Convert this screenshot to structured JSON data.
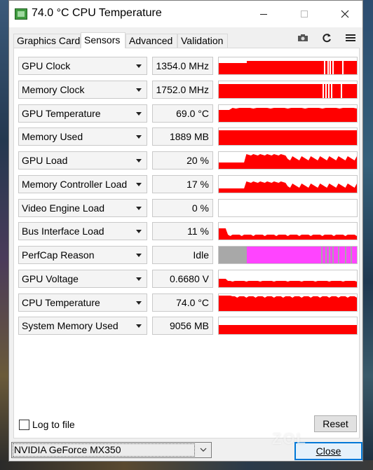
{
  "window": {
    "title": "74.0 °C CPU Temperature",
    "buttons": {
      "minimize": "minimize",
      "maximize": "maximize",
      "close": "close"
    }
  },
  "tabs": [
    {
      "label": "Graphics Card"
    },
    {
      "label": "Sensors",
      "active": true
    },
    {
      "label": "Advanced"
    },
    {
      "label": "Validation"
    }
  ],
  "toolbar": {
    "icons": [
      "camera-icon",
      "refresh-icon",
      "menu-icon"
    ]
  },
  "sensors": [
    {
      "name": "GPU Clock",
      "value": "1354.0 MHz",
      "graph": "clock"
    },
    {
      "name": "Memory Clock",
      "value": "1752.0 MHz",
      "graph": "memclock"
    },
    {
      "name": "GPU Temperature",
      "value": "69.0 °C",
      "graph": "temp"
    },
    {
      "name": "Memory Used",
      "value": "1889 MB",
      "graph": "full"
    },
    {
      "name": "GPU Load",
      "value": "20 %",
      "graph": "load"
    },
    {
      "name": "Memory Controller Load",
      "value": "17 %",
      "graph": "mcload"
    },
    {
      "name": "Video Engine Load",
      "value": "0 %",
      "graph": "empty"
    },
    {
      "name": "Bus Interface Load",
      "value": "11 %",
      "graph": "bus"
    },
    {
      "name": "PerfCap Reason",
      "value": "Idle",
      "graph": "perfcap"
    },
    {
      "name": "GPU Voltage",
      "value": "0.6680 V",
      "graph": "voltage"
    },
    {
      "name": "CPU Temperature",
      "value": "74.0 °C",
      "graph": "cputemp"
    },
    {
      "name": "System Memory Used",
      "value": "9056 MB",
      "graph": "sysmem"
    }
  ],
  "colors": {
    "graph": "#ff0000",
    "perfcap_idle": "#ff44ff",
    "perfcap_gray": "#a8a8a8"
  },
  "footer": {
    "log_label": "Log to file",
    "reset_label": "Reset",
    "gpu_selected": "NVIDIA GeForce MX350",
    "close_label": "Close"
  },
  "watermark": {
    "text": "ZOL"
  }
}
